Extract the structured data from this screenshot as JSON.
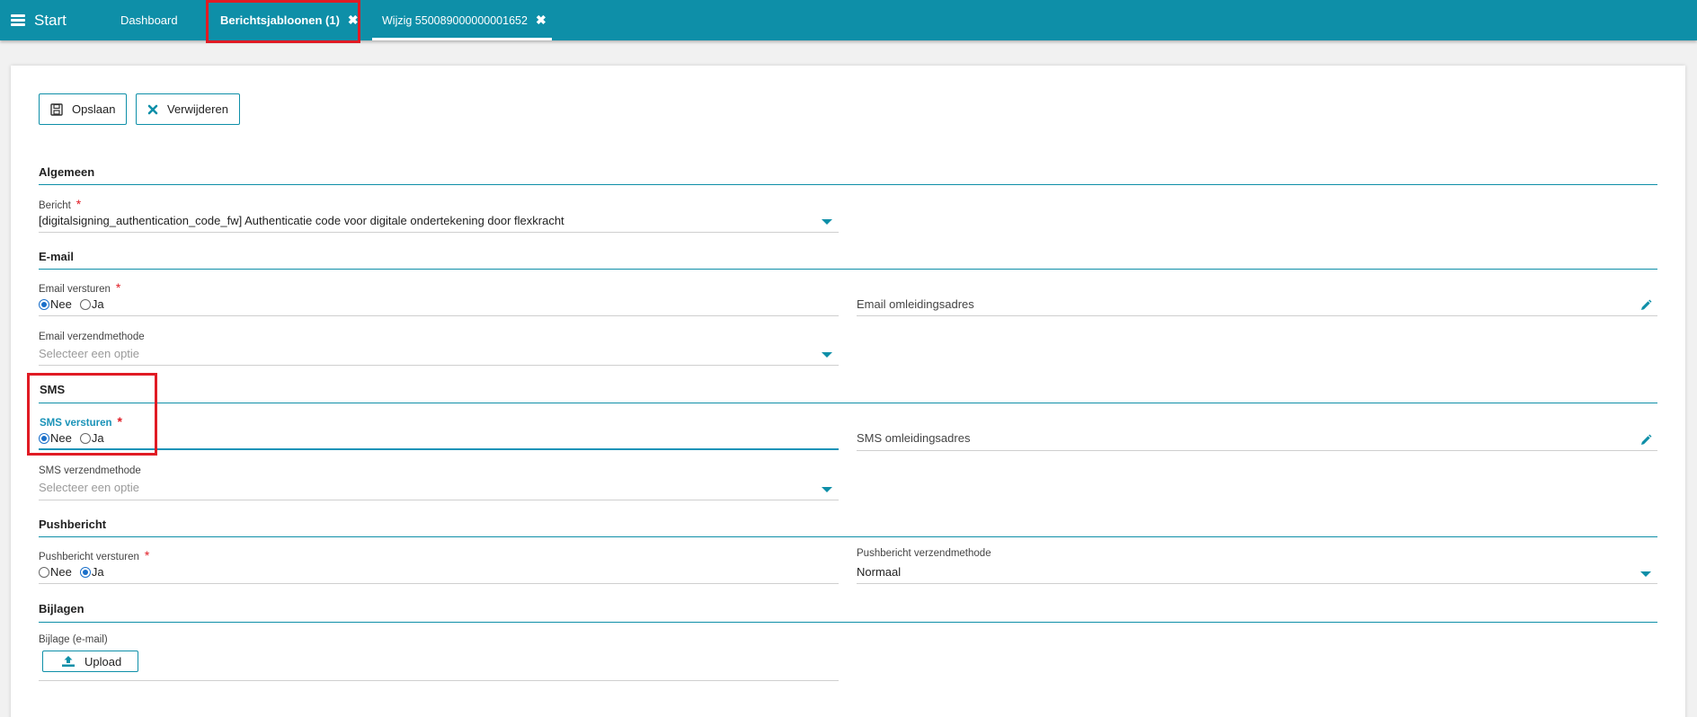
{
  "topbar": {
    "start_label": "Start",
    "tabs": [
      {
        "label": "Dashboard"
      },
      {
        "label": "Berichtsjabloonen (1)"
      },
      {
        "label": "Wijzig 550089000000001652"
      }
    ],
    "close_glyph": "✖"
  },
  "toolbar": {
    "save_label": "Opslaan",
    "delete_label": "Verwijderen"
  },
  "sections": {
    "algemeen": "Algemeen",
    "email": "E-mail",
    "sms": "SMS",
    "push": "Pushbericht",
    "bijlagen": "Bijlagen"
  },
  "fields": {
    "bericht": {
      "label": "Bericht",
      "value": "[digitalsigning_authentication_code_fw] Authenticatie code voor digitale ondertekening door flexkracht"
    },
    "email_versturen": {
      "label": "Email versturen",
      "options": [
        "Nee",
        "Ja"
      ],
      "selected": "Nee"
    },
    "email_omleidingsadres": {
      "placeholder": "Email omleidingsadres"
    },
    "email_verzendmethode": {
      "label": "Email verzendmethode",
      "placeholder": "Selecteer een optie"
    },
    "sms_versturen": {
      "label": "SMS versturen",
      "options": [
        "Nee",
        "Ja"
      ],
      "selected": "Nee"
    },
    "sms_omleidingsadres": {
      "placeholder": "SMS omleidingsadres"
    },
    "sms_verzendmethode": {
      "label": "SMS verzendmethode",
      "placeholder": "Selecteer een optie"
    },
    "push_versturen": {
      "label": "Pushbericht versturen",
      "options": [
        "Nee",
        "Ja"
      ],
      "selected": "Ja"
    },
    "push_verzendmethode": {
      "label": "Pushbericht verzendmethode",
      "value": "Normaal"
    },
    "bijlage": {
      "label": "Bijlage (e-mail)",
      "button": "Upload"
    }
  },
  "required_marker": "*",
  "colors": {
    "accent": "#0e8fa8",
    "required": "#e01b24",
    "highlight": "#e01b24",
    "focus": "#1a93b8"
  }
}
